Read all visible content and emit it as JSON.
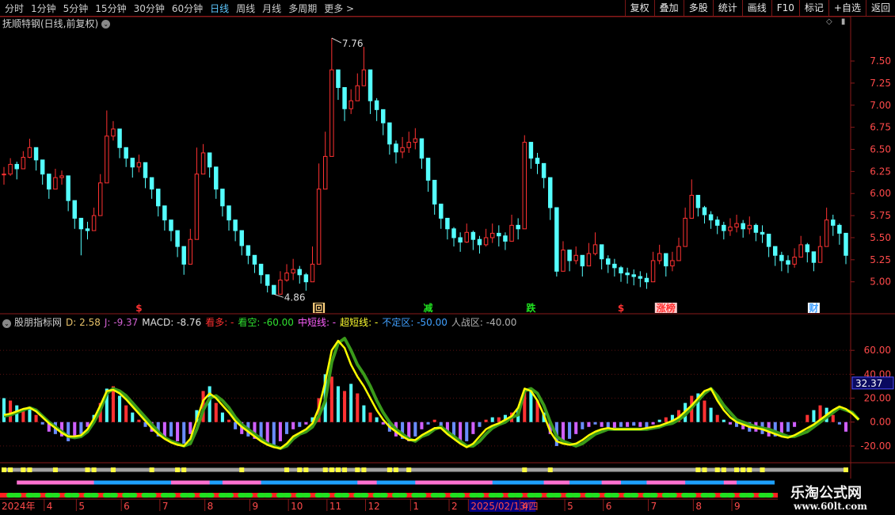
{
  "topbar": {
    "periods": [
      "分时",
      "1分钟",
      "5分钟",
      "15分钟",
      "30分钟",
      "60分钟",
      "日线",
      "周线",
      "月线",
      "多周期",
      "更多 >"
    ],
    "active_index": 6,
    "buttons": [
      "复权",
      "叠加",
      "多股",
      "统计",
      "画线",
      "F10",
      "标记",
      "+自选",
      "返回"
    ]
  },
  "main_title": "抚顺特钢(日线,前复权)",
  "indicator_legend": [
    {
      "text": "股朋指标网",
      "color": "#cfcfcf"
    },
    {
      "text": "D: 2.58",
      "color": "#e8c26a"
    },
    {
      "text": "J: -9.37",
      "color": "#d060d0"
    },
    {
      "text": "MACD: -8.76",
      "color": "#e0e0e0"
    },
    {
      "text": "看多: -",
      "color": "#ff3030"
    },
    {
      "text": "看空: -60.00",
      "color": "#30e030"
    },
    {
      "text": "中短线: -",
      "color": "#ff60ff"
    },
    {
      "text": "超短线: -",
      "color": "#ffff30"
    },
    {
      "text": "不定区: -50.00",
      "color": "#40a0ff"
    },
    {
      "text": "人战区: -40.00",
      "color": "#b0b0b0"
    }
  ],
  "colors": {
    "up": "#ff3232",
    "down": "#54ffff",
    "axis": "#8a1a1a",
    "grid": "#5a1212",
    "ema": "#3a9a1a",
    "fast": "#ffff00"
  },
  "markers": [
    {
      "i": 21,
      "text": "$",
      "color": "#ff3232",
      "bg": ""
    },
    {
      "i": 49,
      "text": "回",
      "color": "#000000",
      "bg": "#ffd27f"
    },
    {
      "i": 66,
      "text": "减",
      "color": "#20e020",
      "bg": ""
    },
    {
      "i": 82,
      "text": "跌",
      "color": "#20e020",
      "bg": ""
    },
    {
      "i": 96,
      "text": "$",
      "color": "#ff3232",
      "bg": ""
    },
    {
      "i": 103,
      "text": "涨榜",
      "color": "#ff3232",
      "bg": "#ffcccc"
    },
    {
      "i": 126,
      "text": "财",
      "color": "#40a0ff",
      "bg": "#ffffff"
    }
  ],
  "date_labels": [
    "2024年",
    "4",
    "5",
    "6",
    "7",
    "8",
    "9",
    "10",
    "11",
    "12",
    "1",
    "2",
    "2025/02/13/四",
    "4",
    "5",
    "6",
    "7",
    "8",
    "9"
  ],
  "date_label_index": [
    0,
    7,
    12,
    19,
    25,
    32,
    39,
    45,
    51,
    57,
    64,
    70,
    73,
    81,
    88,
    94,
    101,
    108,
    114
  ],
  "cursor_value": "32.37",
  "watermark": {
    "line1": "乐淘公式网",
    "line2": "www.60lt.com"
  },
  "chart_data": {
    "type": "candlestick",
    "title": "抚顺特钢(日线,前复权)",
    "price_axis": {
      "ylim": [
        4.8,
        7.85
      ],
      "ticks": [
        "7.50",
        "7.25",
        "7.00",
        "6.75",
        "6.50",
        "6.25",
        "6.00",
        "5.75",
        "5.50",
        "5.25",
        "5.00"
      ]
    },
    "high_annotation": "7.76",
    "low_annotation": "4.86",
    "price_close": [
      6.22,
      6.33,
      6.28,
      6.41,
      6.52,
      6.38,
      6.22,
      6.05,
      6.18,
      6.2,
      5.92,
      5.72,
      5.6,
      5.58,
      5.75,
      6.12,
      6.65,
      6.73,
      6.52,
      6.4,
      6.3,
      6.35,
      6.18,
      6.05,
      5.86,
      5.7,
      5.58,
      5.4,
      5.2,
      5.48,
      6.22,
      6.46,
      6.3,
      6.05,
      5.86,
      5.7,
      5.58,
      5.41,
      5.3,
      5.2,
      5.08,
      4.96,
      4.86,
      5.02,
      5.1,
      5.14,
      5.08,
      5.0,
      5.2,
      6.05,
      6.42,
      7.4,
      7.2,
      6.96,
      7.05,
      7.22,
      7.4,
      7.05,
      6.95,
      6.8,
      6.56,
      6.47,
      6.52,
      6.58,
      6.62,
      6.4,
      6.15,
      5.88,
      5.72,
      5.6,
      5.5,
      5.45,
      5.56,
      5.48,
      5.42,
      5.5,
      5.55,
      5.52,
      5.46,
      5.64,
      5.6,
      6.58,
      6.4,
      6.34,
      6.18,
      5.84,
      5.12,
      5.36,
      5.24,
      5.3,
      5.18,
      5.32,
      5.42,
      5.26,
      5.2,
      5.16,
      5.1,
      5.08,
      5.06,
      5.04,
      5.0,
      5.24,
      5.32,
      5.18,
      5.24,
      5.4,
      5.72,
      5.98,
      5.84,
      5.76,
      5.7,
      5.64,
      5.58,
      5.62,
      5.66,
      5.6,
      5.64,
      5.56,
      5.54,
      5.4,
      5.3,
      5.24,
      5.2,
      5.28,
      5.42,
      5.34,
      5.22,
      5.4,
      5.7,
      5.64,
      5.55,
      5.3
    ],
    "price_high": [
      6.3,
      6.4,
      6.36,
      6.48,
      6.62,
      6.48,
      6.3,
      6.16,
      6.28,
      6.26,
      6.0,
      5.82,
      5.72,
      5.68,
      5.84,
      6.22,
      6.94,
      6.82,
      6.64,
      6.52,
      6.4,
      6.44,
      6.3,
      6.16,
      5.96,
      5.8,
      5.7,
      5.52,
      5.34,
      5.6,
      6.52,
      6.56,
      6.4,
      6.16,
      5.96,
      5.82,
      5.68,
      5.52,
      5.4,
      5.3,
      5.18,
      5.06,
      4.96,
      5.12,
      5.2,
      5.26,
      5.18,
      5.1,
      5.4,
      6.34,
      6.7,
      7.76,
      7.4,
      7.12,
      7.18,
      7.36,
      7.66,
      7.2,
      7.08,
      6.92,
      6.68,
      6.6,
      6.64,
      6.7,
      6.74,
      6.52,
      6.26,
      6.0,
      5.84,
      5.7,
      5.62,
      5.56,
      5.66,
      5.58,
      5.52,
      5.6,
      5.66,
      5.64,
      5.56,
      5.76,
      5.72,
      6.66,
      6.52,
      6.46,
      6.3,
      5.98,
      5.46,
      5.46,
      5.34,
      5.4,
      5.28,
      5.44,
      5.56,
      5.38,
      5.3,
      5.26,
      5.18,
      5.16,
      5.14,
      5.12,
      5.1,
      5.34,
      5.42,
      5.28,
      5.34,
      5.5,
      5.84,
      6.16,
      5.96,
      5.86,
      5.8,
      5.74,
      5.68,
      5.72,
      5.76,
      5.7,
      5.74,
      5.66,
      5.64,
      5.52,
      5.4,
      5.34,
      5.3,
      5.38,
      5.52,
      5.44,
      5.32,
      5.52,
      5.84,
      5.76,
      5.66,
      5.4
    ],
    "price_low": [
      6.1,
      6.2,
      6.16,
      6.3,
      6.4,
      6.26,
      6.1,
      5.94,
      6.06,
      6.1,
      5.8,
      5.6,
      5.3,
      5.48,
      5.62,
      5.98,
      6.48,
      6.6,
      6.4,
      6.3,
      6.18,
      6.24,
      6.06,
      5.94,
      5.74,
      5.58,
      5.46,
      5.28,
      5.08,
      5.36,
      6.08,
      6.32,
      6.18,
      5.94,
      5.74,
      5.58,
      5.46,
      5.3,
      5.2,
      5.1,
      4.98,
      4.88,
      4.86,
      4.9,
      5.0,
      5.02,
      4.98,
      4.9,
      5.1,
      5.8,
      6.28,
      7.2,
      7.06,
      6.82,
      6.9,
      7.08,
      7.22,
      6.9,
      6.82,
      6.66,
      6.44,
      6.34,
      6.4,
      6.46,
      6.5,
      6.28,
      6.02,
      5.76,
      5.6,
      5.48,
      5.4,
      5.34,
      5.44,
      5.36,
      5.32,
      5.4,
      5.44,
      5.4,
      5.36,
      5.52,
      5.48,
      6.36,
      6.28,
      6.22,
      6.06,
      5.7,
      5.06,
      5.14,
      5.12,
      5.2,
      5.06,
      5.2,
      5.3,
      5.14,
      5.1,
      5.06,
      5.0,
      4.98,
      4.96,
      4.94,
      4.92,
      5.12,
      5.2,
      5.06,
      5.12,
      5.28,
      5.56,
      5.84,
      5.74,
      5.66,
      5.6,
      5.54,
      5.48,
      5.52,
      5.56,
      5.5,
      5.54,
      5.46,
      5.44,
      5.28,
      5.18,
      5.12,
      5.1,
      5.16,
      5.3,
      5.22,
      5.12,
      5.26,
      5.56,
      5.52,
      5.42,
      5.2
    ],
    "indicator_axis": {
      "ylim": [
        -28,
        80
      ],
      "ticks": [
        "60.00",
        "40.00",
        "20.00",
        "0.00",
        "-20.00"
      ]
    },
    "slow_line": [
      5,
      6,
      8,
      10,
      12,
      10,
      5,
      0,
      -4,
      -8,
      -12,
      -13,
      -12,
      -8,
      0,
      10,
      24,
      28,
      26,
      22,
      16,
      10,
      4,
      -2,
      -8,
      -13,
      -16,
      -18,
      -20,
      -18,
      -6,
      10,
      20,
      22,
      18,
      12,
      4,
      -2,
      -6,
      -10,
      -14,
      -18,
      -20,
      -22,
      -20,
      -14,
      -10,
      -8,
      -4,
      5,
      18,
      50,
      66,
      70,
      60,
      48,
      40,
      30,
      18,
      8,
      0,
      -6,
      -10,
      -14,
      -16,
      -12,
      -10,
      -6,
      -4,
      -8,
      -12,
      -16,
      -20,
      -20,
      -16,
      -10,
      -5,
      -2,
      0,
      4,
      6,
      26,
      28,
      24,
      14,
      0,
      -12,
      -16,
      -18,
      -20,
      -18,
      -14,
      -10,
      -8,
      -6,
      -6,
      -6,
      -6,
      -6,
      -6,
      -6,
      -5,
      -4,
      -2,
      -1,
      2,
      6,
      12,
      18,
      24,
      28,
      22,
      14,
      8,
      2,
      0,
      -2,
      -4,
      -5,
      -6,
      -8,
      -10,
      -12,
      -12,
      -10,
      -8,
      -4,
      0,
      4,
      8,
      12,
      10,
      8,
      2
    ],
    "fast_line": [
      6,
      7,
      9,
      11,
      12,
      9,
      4,
      -1,
      -5,
      -9,
      -12,
      -12,
      -11,
      -6,
      3,
      14,
      26,
      27,
      24,
      19,
      13,
      7,
      1,
      -5,
      -10,
      -14,
      -17,
      -19,
      -20,
      -14,
      2,
      18,
      24,
      20,
      14,
      8,
      1,
      -4,
      -8,
      -12,
      -16,
      -19,
      -21,
      -22,
      -18,
      -12,
      -9,
      -6,
      -1,
      12,
      34,
      60,
      68,
      62,
      48,
      38,
      30,
      20,
      10,
      2,
      -4,
      -8,
      -12,
      -15,
      -15,
      -11,
      -8,
      -5,
      -5,
      -10,
      -14,
      -18,
      -21,
      -18,
      -12,
      -6,
      -3,
      -1,
      2,
      5,
      12,
      28,
      26,
      18,
      6,
      -8,
      -16,
      -18,
      -19,
      -18,
      -15,
      -11,
      -8,
      -6,
      -5,
      -6,
      -6,
      -6,
      -6,
      -6,
      -5,
      -4,
      -3,
      -1,
      1,
      4,
      9,
      14,
      20,
      26,
      28,
      18,
      10,
      4,
      0,
      -2,
      -4,
      -5,
      -6,
      -8,
      -10,
      -12,
      -13,
      -11,
      -8,
      -5,
      -2,
      2,
      6,
      10,
      13,
      11,
      7,
      2
    ],
    "hist": [
      20,
      18,
      14,
      10,
      12,
      6,
      -2,
      -8,
      -10,
      -12,
      -16,
      -14,
      -10,
      -4,
      6,
      16,
      28,
      30,
      22,
      14,
      8,
      2,
      -4,
      -8,
      -12,
      -14,
      -12,
      -16,
      -18,
      -10,
      10,
      26,
      30,
      16,
      8,
      2,
      -6,
      -10,
      -12,
      -14,
      -16,
      -18,
      -20,
      -16,
      -10,
      -6,
      -4,
      -2,
      4,
      20,
      40,
      38,
      30,
      26,
      32,
      24,
      14,
      8,
      4,
      -2,
      -8,
      -12,
      -14,
      -16,
      -12,
      -6,
      -2,
      2,
      -4,
      -10,
      -14,
      -18,
      -16,
      -10,
      -4,
      2,
      4,
      4,
      6,
      8,
      10,
      26,
      26,
      18,
      8,
      -10,
      -20,
      -18,
      -14,
      -10,
      -6,
      -4,
      -2,
      -4,
      -6,
      -5,
      -4,
      -4,
      -3,
      -4,
      -5,
      -2,
      2,
      4,
      6,
      10,
      16,
      22,
      24,
      18,
      12,
      6,
      2,
      -2,
      -4,
      -6,
      -8,
      -8,
      -10,
      -12,
      -12,
      -10,
      -8,
      -4,
      0,
      6,
      10,
      14,
      12,
      6,
      -2,
      -8
    ],
    "dot_flags": [
      1,
      1,
      0,
      1,
      1,
      0,
      0,
      0,
      1,
      0,
      0,
      0,
      0,
      1,
      1,
      0,
      0,
      1,
      0,
      0,
      0,
      0,
      0,
      1,
      0,
      0,
      0,
      1,
      1,
      0,
      0,
      0,
      0,
      0,
      0,
      0,
      0,
      1,
      0,
      0,
      0,
      0,
      0,
      0,
      1,
      0,
      1,
      1,
      0,
      0,
      1,
      1,
      1,
      1,
      0,
      1,
      1,
      0,
      0,
      0,
      1,
      1,
      0,
      1,
      0,
      0,
      0,
      0,
      0,
      0,
      0,
      0,
      0,
      0,
      0,
      0,
      0,
      0,
      0,
      0,
      0,
      1,
      0,
      0,
      0,
      1,
      0,
      0,
      0,
      0,
      0,
      0,
      0,
      0,
      0,
      0,
      0,
      0,
      0,
      0,
      0,
      0,
      0,
      0,
      0,
      0,
      0,
      0,
      1,
      1,
      0,
      1,
      1,
      0,
      1,
      1,
      1,
      0,
      1,
      0,
      0,
      0,
      0,
      0,
      0,
      0,
      0,
      0,
      0,
      0,
      0,
      1,
      0,
      0
    ],
    "band_pink": [
      [
        2,
        14
      ],
      [
        26,
        32
      ],
      [
        34,
        40
      ],
      [
        55,
        58
      ],
      [
        64,
        76
      ],
      [
        84,
        88
      ],
      [
        93,
        96
      ],
      [
        100,
        106
      ],
      [
        112,
        114
      ]
    ]
  }
}
